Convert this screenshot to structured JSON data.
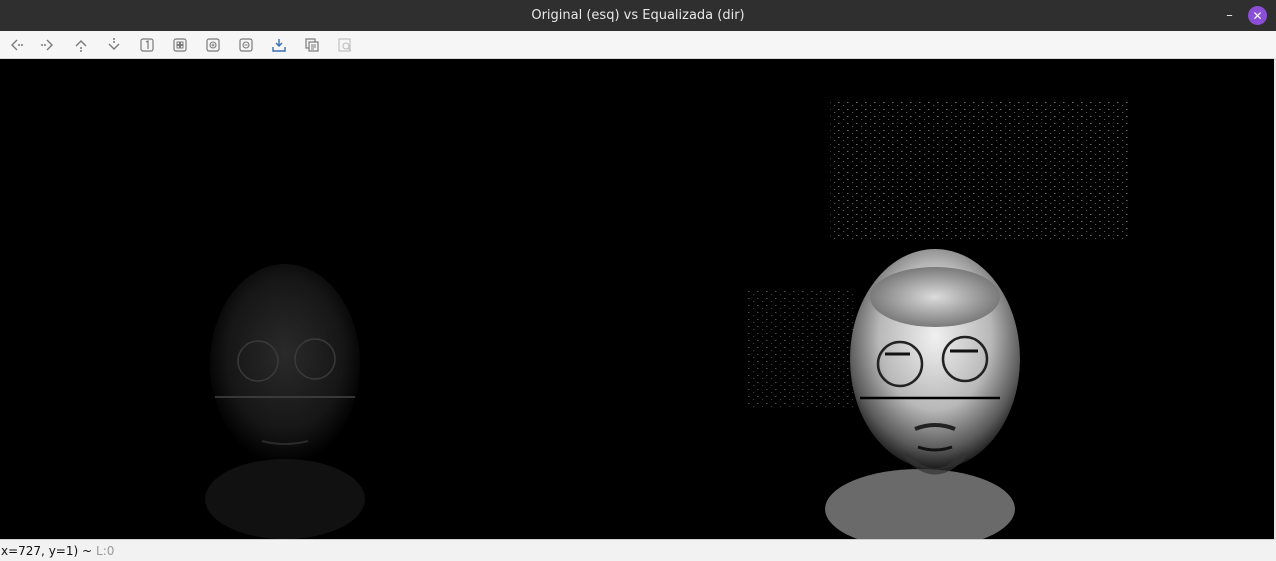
{
  "window": {
    "title": "Original (esq) vs Equalizada (dir)",
    "minimize_glyph": "–",
    "close_glyph": "✕"
  },
  "toolbar": {
    "buttons": [
      {
        "name": "pan-left-icon"
      },
      {
        "name": "pan-right-icon"
      },
      {
        "name": "pan-up-icon"
      },
      {
        "name": "pan-down-icon"
      },
      {
        "name": "zoom-actual-size-icon"
      },
      {
        "name": "zoom-fit-icon"
      },
      {
        "name": "zoom-in-icon"
      },
      {
        "name": "zoom-out-icon"
      },
      {
        "name": "save-icon"
      },
      {
        "name": "copy-icon"
      },
      {
        "name": "properties-icon"
      }
    ]
  },
  "images": {
    "left_label": "Original (esq)",
    "right_label": "Equalizada (dir)"
  },
  "status": {
    "coords": "x=727, y=1) ~",
    "layer": "L:0"
  },
  "colors": {
    "titlebar": "#2f2f2f",
    "close_button": "#8a4fd6",
    "canvas": "#000000"
  }
}
